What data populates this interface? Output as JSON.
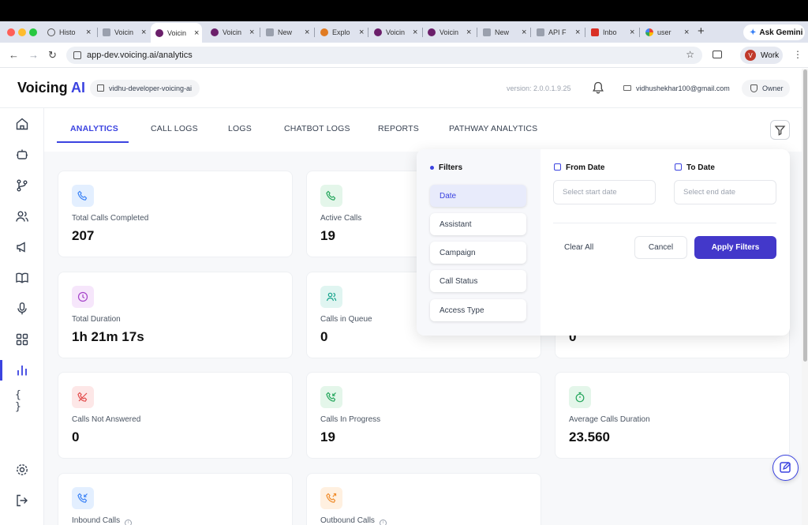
{
  "browser": {
    "tabs": [
      {
        "label": "Histo"
      },
      {
        "label": "Voicin"
      },
      {
        "label": "Voicin"
      },
      {
        "label": "Voicin"
      },
      {
        "label": "New"
      },
      {
        "label": "Explo"
      },
      {
        "label": "Voicin"
      },
      {
        "label": "Voicin"
      },
      {
        "label": "New"
      },
      {
        "label": "API F"
      },
      {
        "label": "Inbo"
      },
      {
        "label": "user"
      }
    ],
    "ask_gemini": "Ask Gemini",
    "url": "app-dev.voicing.ai/analytics",
    "profile_label": "Work",
    "profile_initial": "V"
  },
  "header": {
    "logo_main": "Voicing",
    "logo_accent": "AI",
    "org": "vidhu-developer-voicing-ai",
    "version": "version: 2.0.0.1.9.25",
    "email": "vidhushekhar100@gmail.com",
    "role": "Owner"
  },
  "nav_tabs": [
    {
      "label": "ANALYTICS"
    },
    {
      "label": "CALL LOGS"
    },
    {
      "label": "LOGS"
    },
    {
      "label": "CHATBOT LOGS"
    },
    {
      "label": "REPORTS"
    },
    {
      "label": "PATHWAY ANALYTICS"
    }
  ],
  "cards": [
    {
      "label": "Total Calls Completed",
      "value": "207"
    },
    {
      "label": "Active Calls",
      "value": "19"
    },
    {
      "label": "Total Duration",
      "value": "1h 21m 17s"
    },
    {
      "label": "Calls in Queue",
      "value": "0"
    },
    {
      "label": "",
      "value": "0"
    },
    {
      "label": "Calls Not Answered",
      "value": "0"
    },
    {
      "label": "Calls In Progress",
      "value": "19"
    },
    {
      "label": "Average Calls Duration",
      "value": "23.560"
    },
    {
      "label": "Inbound Calls",
      "value": ""
    },
    {
      "label": "Outbound Calls",
      "value": ""
    }
  ],
  "filters": {
    "title": "Filters",
    "items": [
      "Date",
      "Assistant",
      "Campaign",
      "Call Status",
      "Access Type"
    ],
    "from_label": "From Date",
    "to_label": "To Date",
    "from_placeholder": "Select start date",
    "to_placeholder": "Select end date",
    "clear_all": "Clear All",
    "cancel": "Cancel",
    "apply": "Apply Filters"
  },
  "colors": {
    "accent": "#3b43e0",
    "apply_button": "#4338ca"
  }
}
